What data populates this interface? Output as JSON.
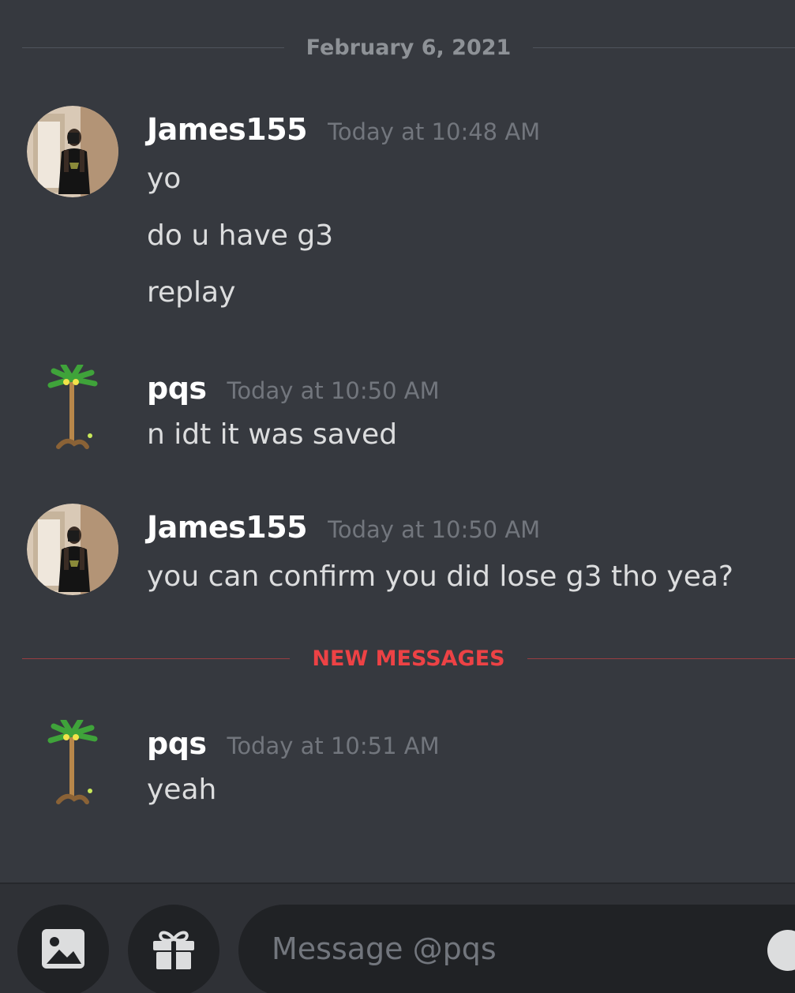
{
  "date_divider": "February 6, 2021",
  "new_messages_label": "NEW MESSAGES",
  "groups": [
    {
      "username": "James155",
      "timestamp": "Today at 10:48 AM",
      "lines": [
        "yo",
        "do u have g3",
        "replay"
      ]
    },
    {
      "username": "pqs",
      "timestamp": "Today at 10:50 AM",
      "lines": [
        "n idt it was saved"
      ]
    },
    {
      "username": "James155",
      "timestamp": "Today at 10:50 AM",
      "lines": [
        "you can confirm you did lose g3 tho yea?"
      ]
    },
    {
      "username": "pqs",
      "timestamp": "Today at 10:51 AM",
      "lines": [
        "yeah"
      ]
    }
  ],
  "composer": {
    "placeholder": "Message @pqs",
    "image_icon": "image-icon",
    "gift_icon": "gift-icon",
    "emoji_icon": "emoji-icon"
  },
  "colors": {
    "background": "#36393f",
    "accent_red": "#ed4245",
    "username": "#ffffff",
    "timestamp": "#72767d"
  }
}
